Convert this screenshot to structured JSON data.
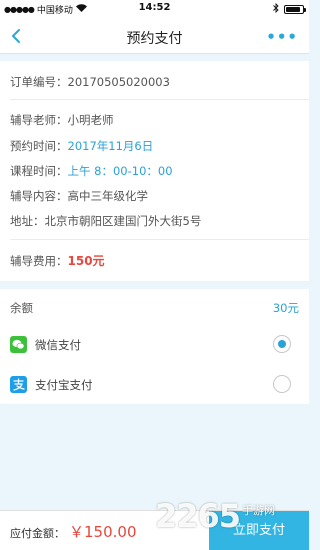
{
  "status_bar": {
    "carrier": "中国移动",
    "time": "14:52",
    "battery_level": 0.85
  },
  "nav": {
    "title": "预约支付",
    "more": "•••"
  },
  "order": {
    "order_no_label": "订单编号：",
    "order_no": "20170505020003",
    "teacher_label": "辅导老师：",
    "teacher": "小明老师",
    "date_label": "预约时间：",
    "date": "2017年11月6日",
    "time_label": "课程时间：",
    "time": "上午 8：00-10：00",
    "content_label": "辅导内容：",
    "content": "高中三年级化学",
    "address_label": "地址：",
    "address": "北京市朝阳区建国门外大街5号",
    "fee_label": "辅导费用：",
    "fee": "150元"
  },
  "payment": {
    "balance_label": "余额",
    "balance_amount": "30元",
    "methods": [
      {
        "label": "微信支付",
        "icon": "wechat-pay-icon",
        "selected": true
      },
      {
        "label": "支付宝支付",
        "icon": "alipay-icon",
        "selected": false
      }
    ]
  },
  "bottom": {
    "total_label": "应付金额：",
    "total_value": "￥150.00",
    "pay_button": "立即支付"
  },
  "watermark": {
    "big": "2265",
    "small": "手游网"
  },
  "colors": {
    "accent_blue": "#2aa2d6",
    "price_red": "#e8473c",
    "button_blue": "#33b5e3",
    "wechat_green": "#3ec13a",
    "alipay_blue": "#1e9ee8",
    "page_bg": "#eaf6fb"
  }
}
